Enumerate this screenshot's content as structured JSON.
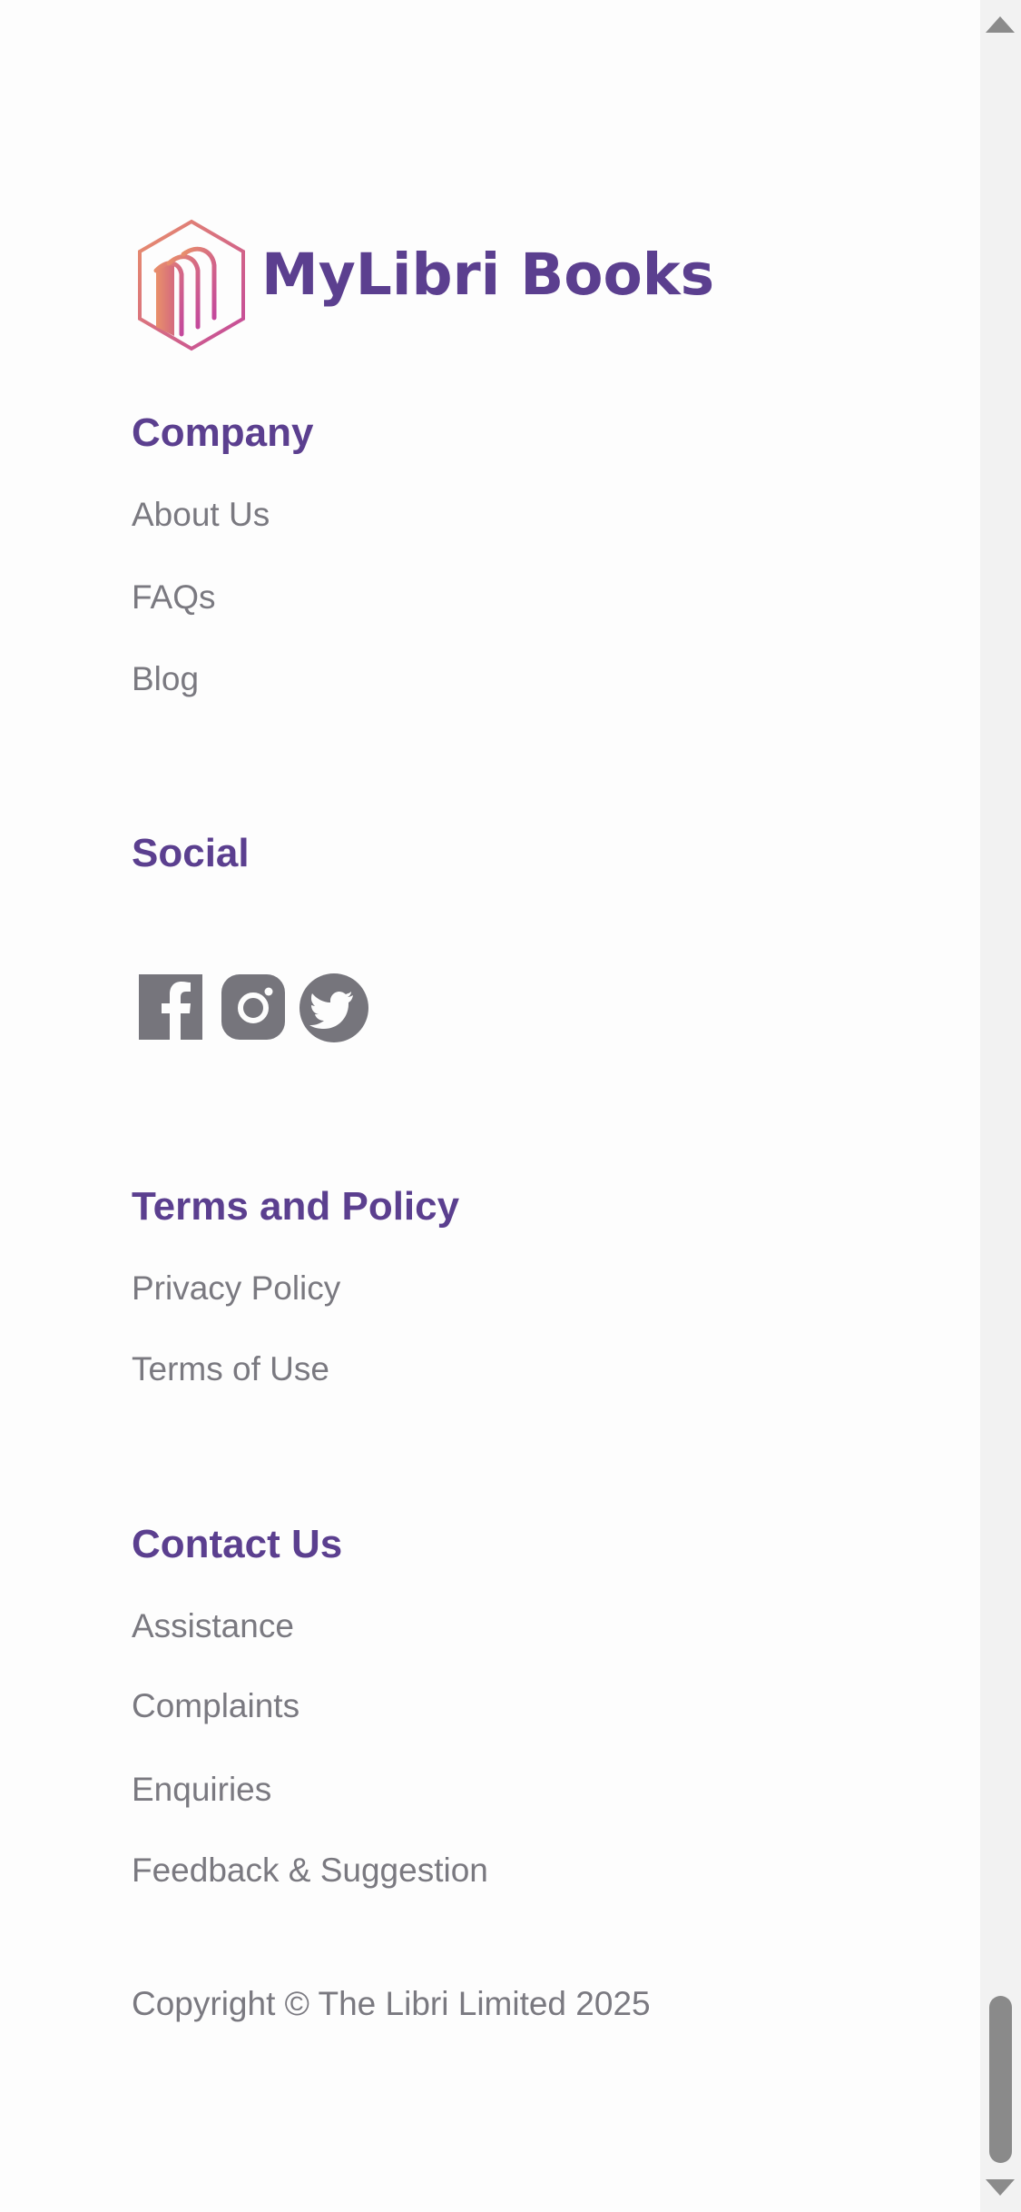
{
  "brand": {
    "name": "MyLibri Books",
    "colors": {
      "primary": "#5b3f8f",
      "gradient_start": "#e9906a",
      "gradient_end": "#c3489c",
      "text_muted": "#7a7980",
      "icon_gray": "#76757c"
    }
  },
  "footer": {
    "company": {
      "heading": "Company",
      "links": [
        "About Us",
        "FAQs",
        "Blog"
      ]
    },
    "social": {
      "heading": "Social",
      "icons": [
        "facebook-icon",
        "instagram-icon",
        "twitter-icon"
      ]
    },
    "terms": {
      "heading": "Terms and Policy",
      "links": [
        "Privacy Policy",
        "Terms of Use"
      ]
    },
    "contact": {
      "heading": "Contact Us",
      "links": [
        "Assistance",
        "Complaints",
        "Enquiries",
        "Feedback & Suggestion"
      ]
    },
    "copyright": "Copyright © The Libri Limited 2025"
  }
}
